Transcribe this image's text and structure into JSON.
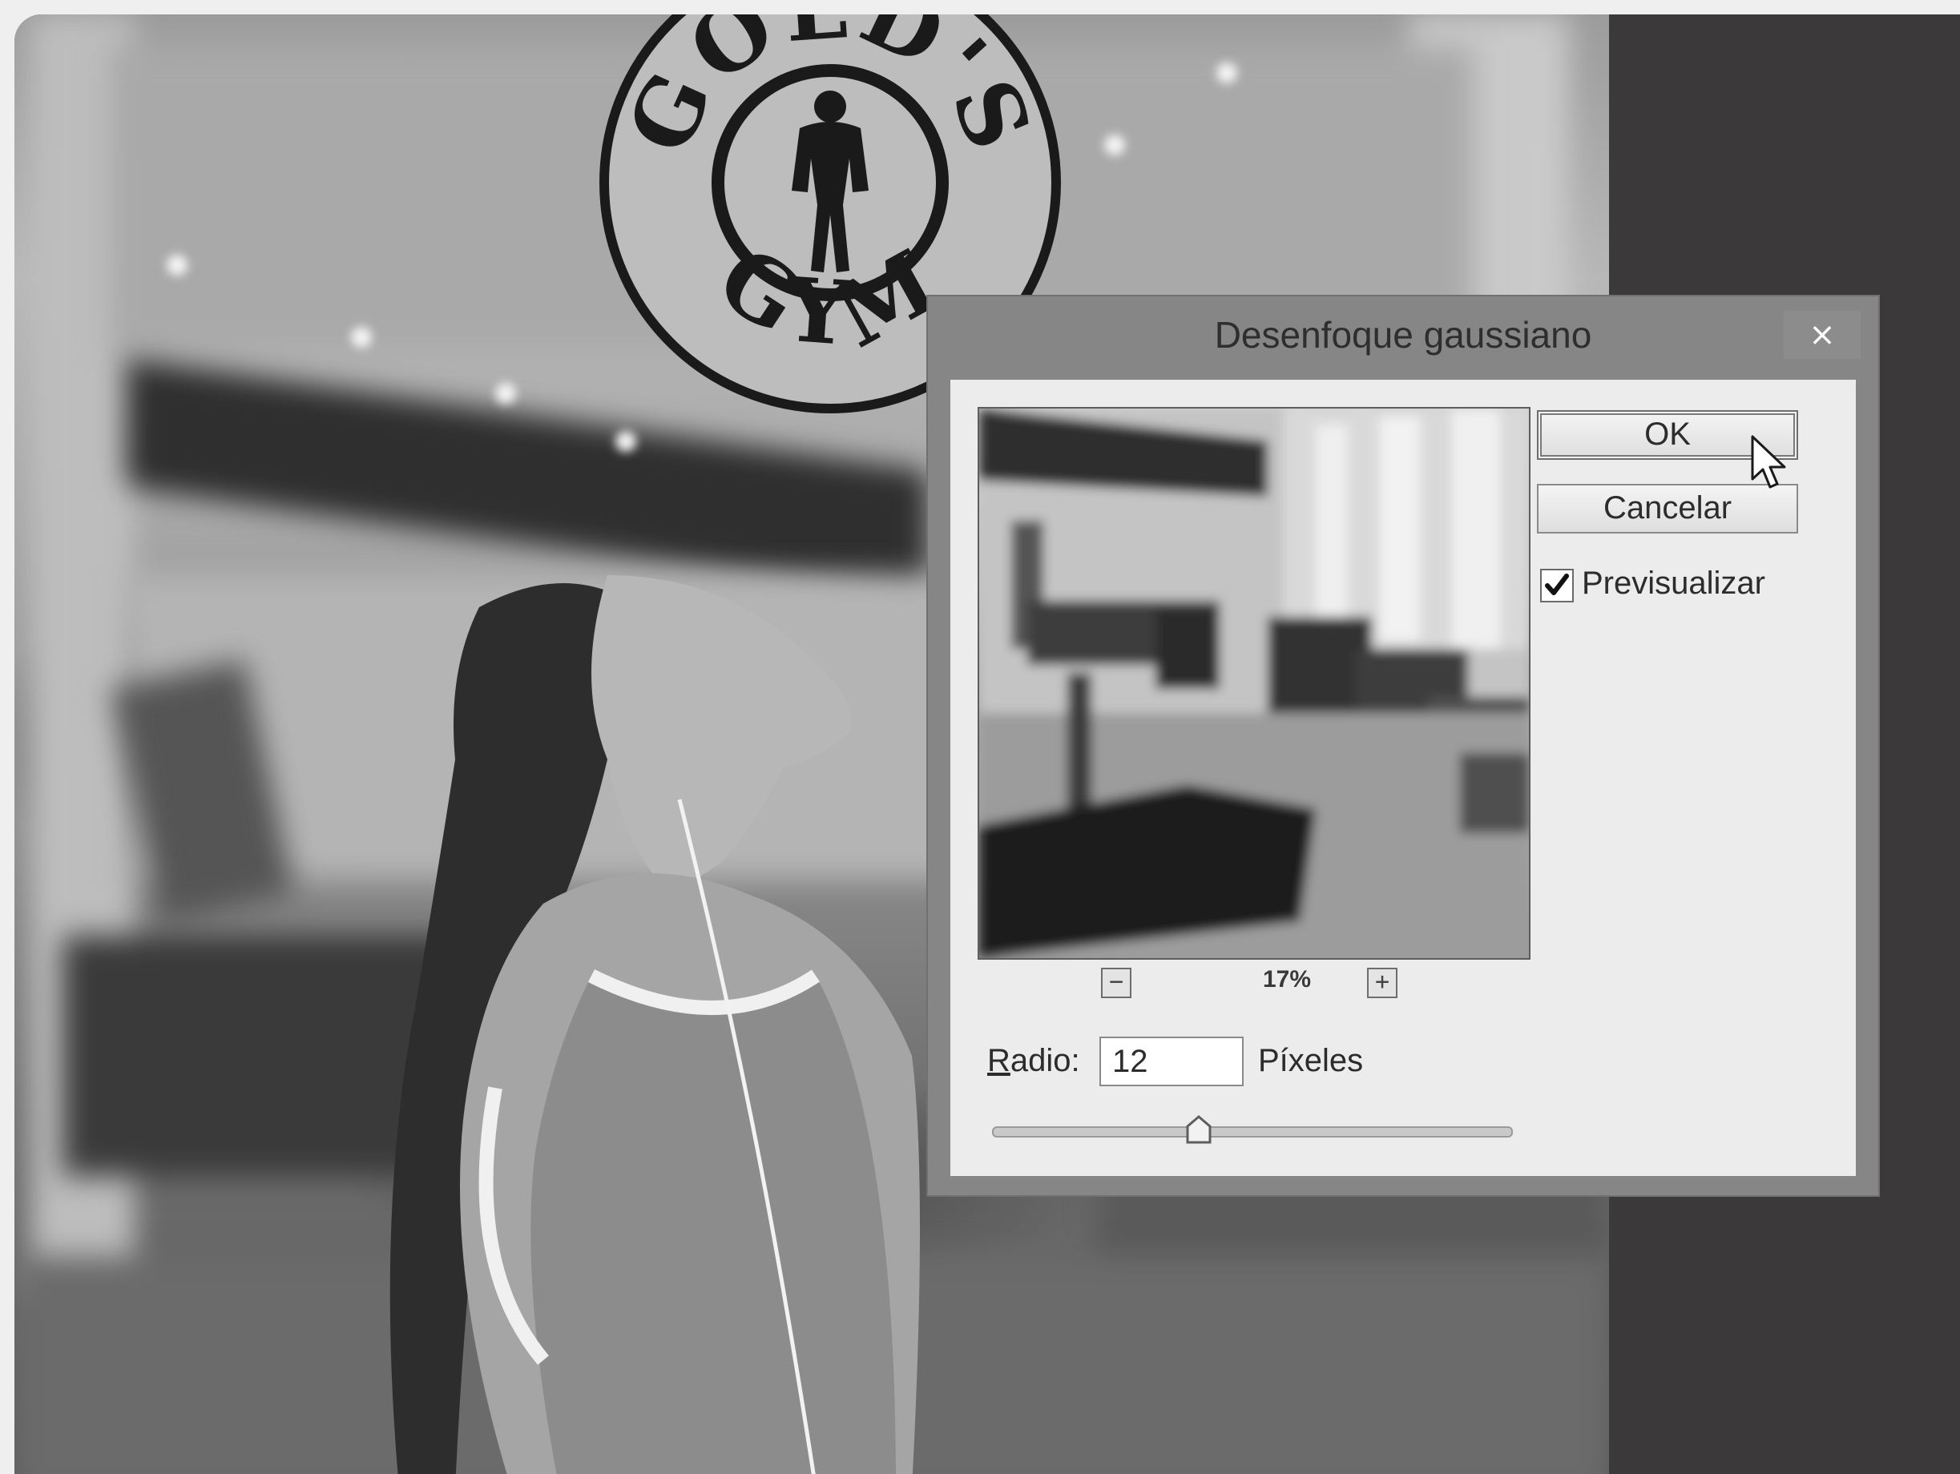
{
  "dialog": {
    "title": "Desenfoque gaussiano",
    "close_glyph": "×",
    "ok_label": "OK",
    "cancel_label": "Cancelar",
    "preview_label": "Previsualizar",
    "preview_checked": true,
    "zoom": {
      "level": "17%",
      "zoom_out_glyph": "−",
      "zoom_in_glyph": "+"
    },
    "radius": {
      "label_first": "R",
      "label_rest": "adio:",
      "value": "12",
      "unit": "Píxeles"
    },
    "slider": {
      "value_fraction": 0.4
    }
  },
  "background": {
    "logo_text_top": "GOLD'S",
    "logo_text_bottom": "GYM"
  },
  "colors": {
    "dialog_frame": "#868686",
    "dialog_body": "#ececec",
    "side_panel": "#3b393a"
  },
  "icons": {
    "close": "close-icon",
    "zoom_out": "zoom-out-icon",
    "zoom_in": "zoom-in-icon",
    "checkbox": "checkmark-icon",
    "cursor": "mouse-pointer-icon"
  }
}
